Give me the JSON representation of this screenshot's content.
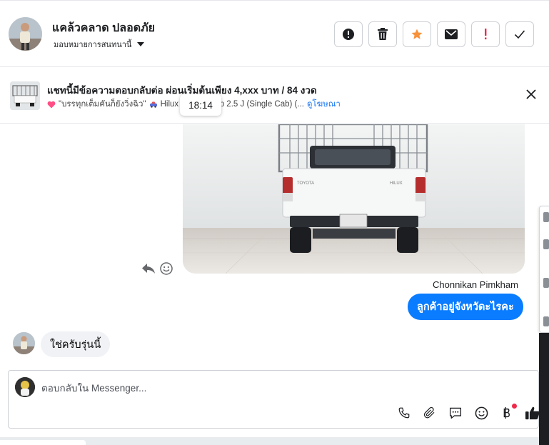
{
  "header": {
    "contact_name": "แคล้วคลาด ปลอดภัย",
    "assign_label": "มอบหมายการสนทนานี้",
    "actions": [
      {
        "icon": "alert-circle-icon"
      },
      {
        "icon": "trash-icon"
      },
      {
        "icon": "star-icon",
        "color": "#f7923a"
      },
      {
        "icon": "envelope-icon"
      },
      {
        "icon": "exclamation-icon",
        "color": "#f02849"
      },
      {
        "icon": "check-icon"
      }
    ]
  },
  "banner": {
    "title": "แชทนี้มีข้อความตอบกลับต่อ ผ่อนเริ่มต้นเพียง 4,xxx บาท / 84 งวด",
    "sub_text": "\"บรรทุกเต็มคันก็ยังวิ่งฉิว\"",
    "sub_model_prefix": "Hilux",
    "sub_model_suffix": "mp 2.5 J (Single Cab) (...",
    "view_ad_link": "ดูโฆษณา",
    "tooltip_time": "18:14"
  },
  "messages": {
    "sender_name": "Chonnikan Pimkham",
    "outgoing_text": "ลูกค้าอยู่จังหวัดะไรคะ",
    "incoming_text": "ใช่ครับรุ่นนี้"
  },
  "composer": {
    "placeholder": "ตอบกลับใน Messenger...",
    "tools": [
      "phone-icon",
      "paperclip-icon",
      "chat-bubble-icon",
      "smiley-icon",
      "baht-icon",
      "thumbs-up-icon"
    ]
  },
  "colors": {
    "accent": "#0a7cff",
    "link": "#1876f2",
    "star": "#f7923a",
    "alert": "#f02849"
  }
}
